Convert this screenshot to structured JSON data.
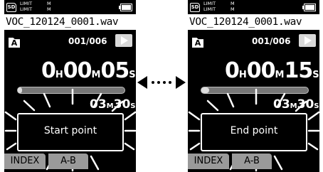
{
  "screens": [
    {
      "sd": "SD",
      "limit_lines": [
        "LIMIT",
        "LIMIT"
      ],
      "mic_lines": [
        "M",
        "M"
      ],
      "filename": "VOC_120124_0001.wav",
      "folder": "A",
      "file_count": "001/006",
      "elapsed": {
        "h": "0",
        "h_unit": "H",
        "m": "00",
        "m_unit": "M",
        "s": "05",
        "s_unit": "S"
      },
      "total": {
        "m": "03",
        "m_unit": "M",
        "s": "30",
        "s_unit": "S"
      },
      "progress": 0.03,
      "message": "Start point",
      "softkeys": [
        "INDEX",
        "A-B"
      ]
    },
    {
      "sd": "SD",
      "limit_lines": [
        "LIMIT",
        "LIMIT"
      ],
      "mic_lines": [
        "M",
        "M"
      ],
      "filename": "VOC_120124_0001.wav",
      "folder": "A",
      "file_count": "001/006",
      "elapsed": {
        "h": "0",
        "h_unit": "H",
        "m": "00",
        "m_unit": "M",
        "s": "15",
        "s_unit": "S"
      },
      "total": {
        "m": "03",
        "m_unit": "M",
        "s": "30",
        "s_unit": "S"
      },
      "progress": 0.07,
      "message": "End point",
      "softkeys": [
        "INDEX",
        "A-B"
      ]
    }
  ],
  "colors": {
    "screen_bg": "#000000",
    "softkey_bg": "#9a9a9a",
    "text": "#ffffff"
  }
}
